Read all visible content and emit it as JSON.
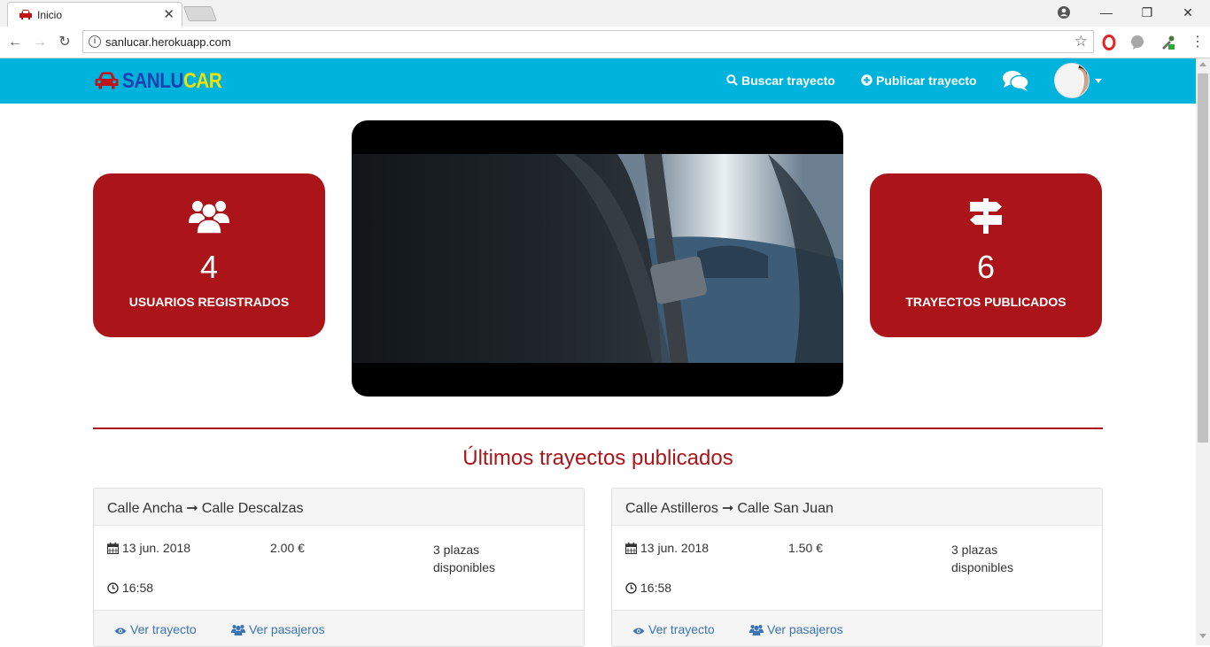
{
  "browser": {
    "tab_title": "Inicio",
    "url": "sanlucar.herokuapp.com"
  },
  "site": {
    "brand_part1": "SANLU",
    "brand_part2": "CAR",
    "nav": {
      "search": "Buscar trayecto",
      "publish": "Publicar trayecto"
    }
  },
  "stats": [
    {
      "icon": "users-icon",
      "value": "4",
      "label": "USUARIOS REGISTRADOS"
    },
    {
      "icon": "signpost-icon",
      "value": "6",
      "label": "TRAYECTOS PUBLICADOS"
    }
  ],
  "section_title": "Últimos trayectos publicados",
  "trips": [
    {
      "from": "Calle Ancha",
      "arrow": "➞",
      "to": "Calle Descalzas",
      "date": "13 jun. 2018",
      "price": "2.00 €",
      "seats": "3 plazas disponibles",
      "time": "16:58",
      "view_trip": "Ver trayecto",
      "view_passengers": "Ver pasajeros"
    },
    {
      "from": "Calle Astilleros",
      "arrow": "➞",
      "to": "Calle San Juan",
      "date": "13 jun. 2018",
      "price": "1.50 €",
      "seats": "3 plazas disponibles",
      "time": "16:58",
      "view_trip": "Ver trayecto",
      "view_passengers": "Ver pasajeros"
    }
  ],
  "colors": {
    "navbar": "#00b3dc",
    "accent": "#ab1419",
    "brand_blue": "#1a3fb0",
    "brand_yellow": "#f2e100",
    "link": "#3a74b5"
  }
}
